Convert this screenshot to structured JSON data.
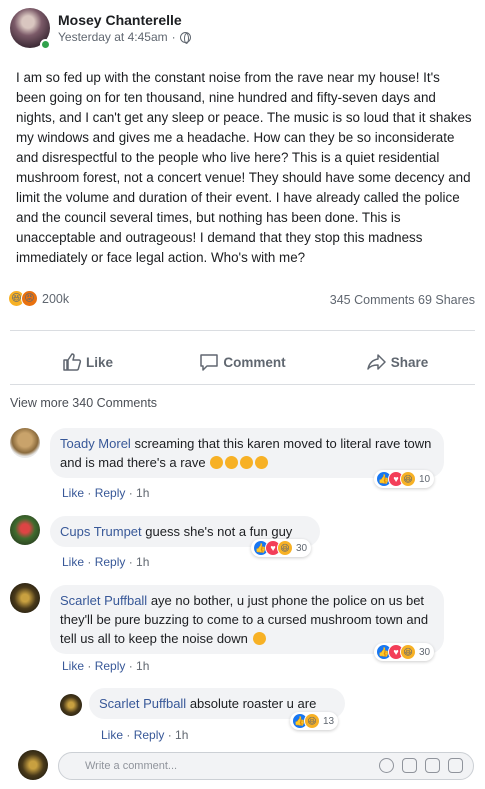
{
  "post": {
    "author": "Mosey Chanterelle",
    "timestamp": "Yesterday at 4:45am",
    "visibility_icon": "globe-icon",
    "text": "I am so fed up with the constant noise from the rave near my house! It's been going on for ten thousand, nine hundred and fifty-seven days and nights, and I can't get any sleep or peace. The music is so loud that it shakes my windows and gives me a headache. How can they be so inconsiderate and disrespectful to the people who live here? This is a quiet residential mushroom forest, not a concert venue! They should have some decency and limit the volume and duration of their event. I have already called the police and the council several times, but nothing has been done. This is unacceptable and outrageous! I demand that they stop this madness immediately or face legal action. Who's with me?",
    "reaction_count": "200k",
    "comments_count": "345 Comments",
    "shares_count": "69 Shares"
  },
  "actions": {
    "like": "Like",
    "comment": "Comment",
    "share": "Share"
  },
  "view_more": "View more 340 Comments",
  "comments": [
    {
      "author": "Toady Morel",
      "text": "screaming that this karen moved to literal rave town and is mad there's a rave",
      "reactions": "10",
      "like": "Like",
      "reply": "Reply",
      "time": "1h"
    },
    {
      "author": "Cups Trumpet",
      "text": "guess she's not a fun guy",
      "reactions": "30",
      "like": "Like",
      "reply": "Reply",
      "time": "1h"
    },
    {
      "author": "Scarlet Puffball",
      "text": "aye no bother, u just phone the police on us bet they'll be pure buzzing to come to a cursed mushroom town and tell us all to keep the noise down",
      "reactions": "30",
      "like": "Like",
      "reply": "Reply",
      "time": "1h"
    },
    {
      "author": "Scarlet Puffball",
      "text": "absolute roaster u are",
      "reactions": "13",
      "like": "Like",
      "reply": "Reply",
      "time": "1h"
    }
  ],
  "composer": {
    "placeholder": "Write a comment..."
  },
  "colors": {
    "link": "#385898",
    "like_blue": "#1877f2",
    "love_red": "#f33e58",
    "haha_yellow": "#f7b125",
    "angry_orange": "#e9710f"
  }
}
